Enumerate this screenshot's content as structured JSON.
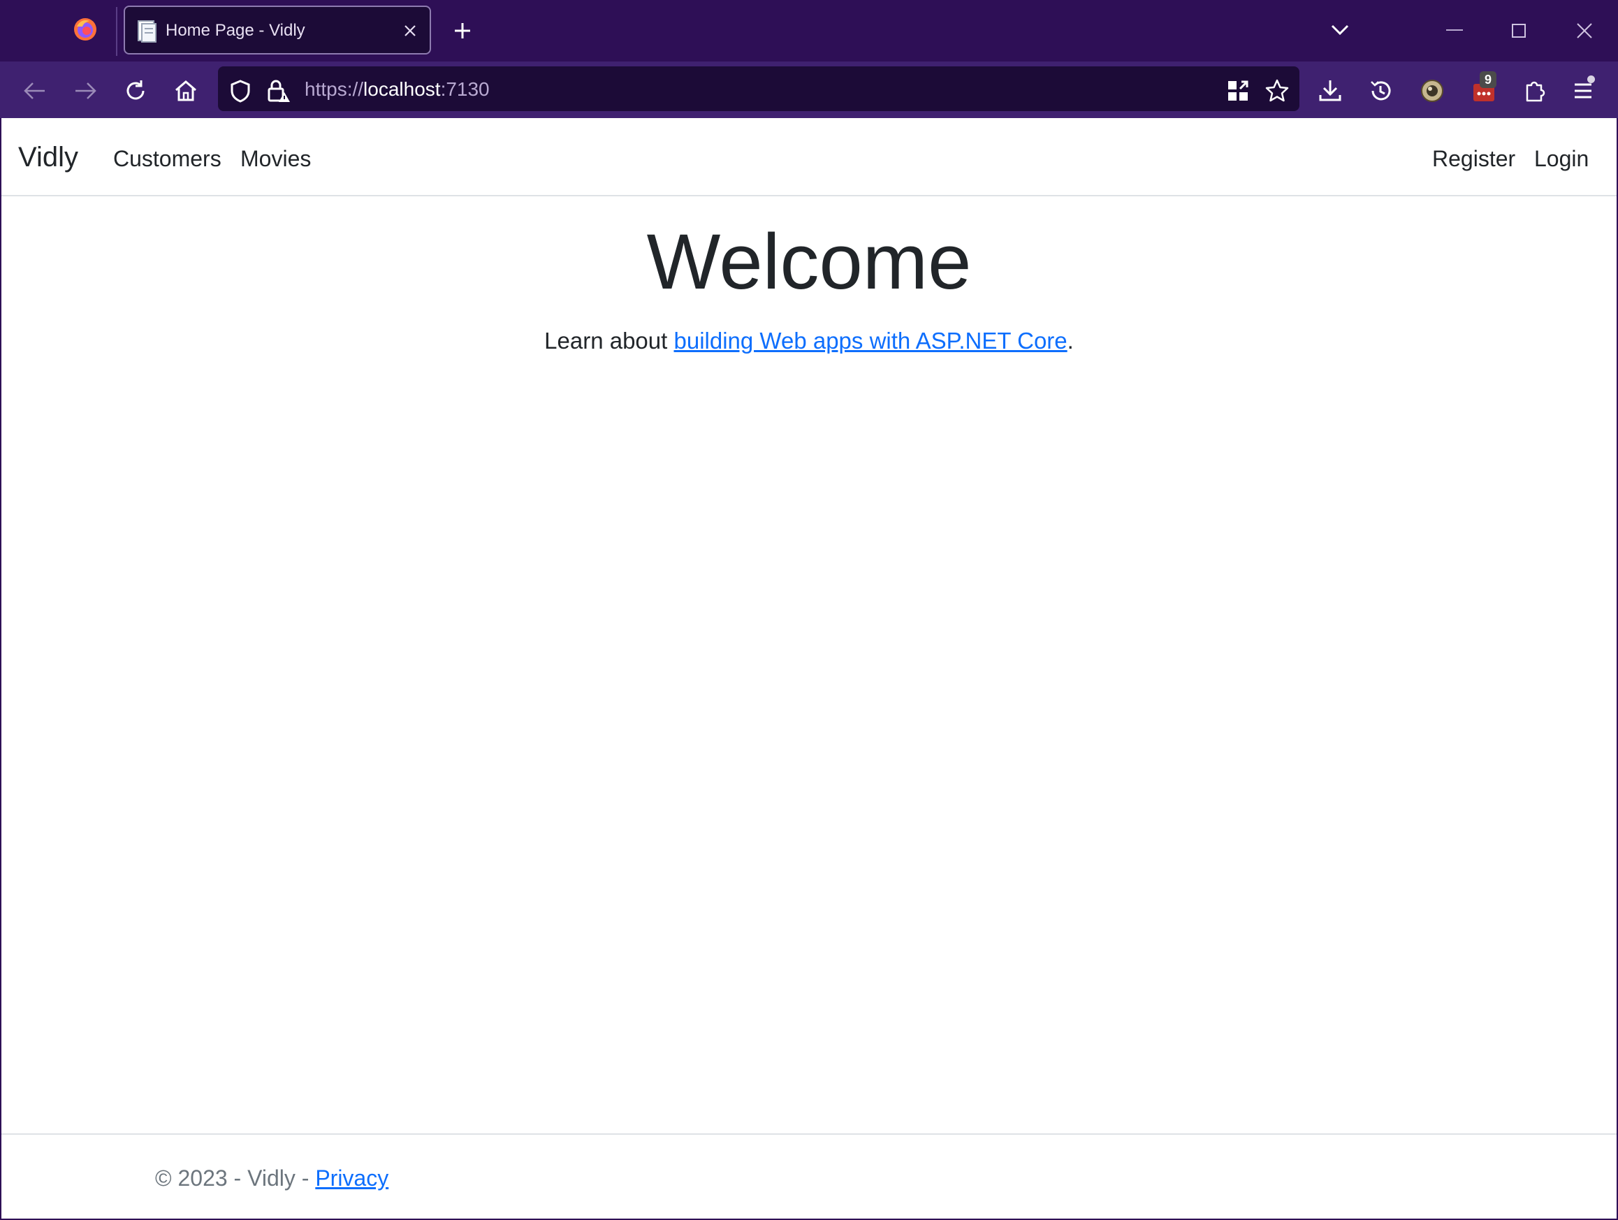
{
  "browser": {
    "tab": {
      "title": "Home Page - Vidly"
    },
    "address": {
      "scheme": "https://",
      "host": "localhost",
      "port": ":7130"
    },
    "extensions_badge": "9",
    "colors": {
      "frame": "#2e0f56",
      "toolbar": "#3f2170",
      "urlbar": "#1c0b37"
    }
  },
  "site": {
    "brand": "Vidly",
    "nav": {
      "customers": "Customers",
      "movies": "Movies",
      "register": "Register",
      "login": "Login"
    },
    "hero": {
      "title": "Welcome",
      "lead_prefix": "Learn about ",
      "lead_link": "building Web apps with ASP.NET Core",
      "lead_suffix": "."
    },
    "footer": {
      "prefix": "© 2023 - Vidly - ",
      "privacy": "Privacy"
    },
    "colors": {
      "text": "#212529",
      "link": "#0d6efd",
      "muted": "#6c757d",
      "border": "#dee2e6"
    }
  }
}
